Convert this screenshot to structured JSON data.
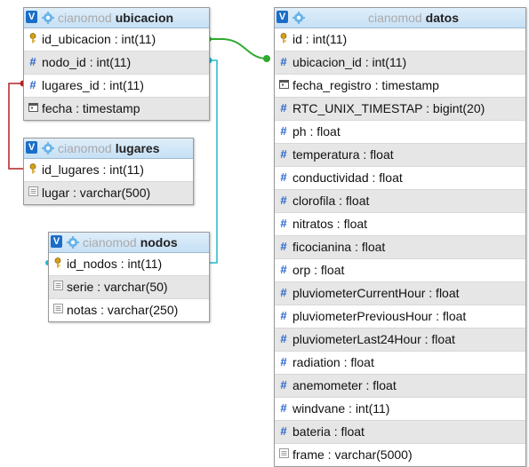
{
  "tables": {
    "ubicacion": {
      "db": "cianomod",
      "name": "ubicacion",
      "columns": [
        {
          "icon": "key-icon",
          "text": "id_ubicacion : int(11)"
        },
        {
          "icon": "hash-icon",
          "text": "nodo_id : int(11)"
        },
        {
          "icon": "hash-icon",
          "text": "lugares_id : int(11)"
        },
        {
          "icon": "calendar-icon",
          "text": "fecha : timestamp"
        }
      ]
    },
    "lugares": {
      "db": "cianomod",
      "name": "lugares",
      "columns": [
        {
          "icon": "key-icon",
          "text": "id_lugares : int(11)"
        },
        {
          "icon": "text-icon",
          "text": "lugar : varchar(500)"
        }
      ]
    },
    "nodos": {
      "db": "cianomod",
      "name": "nodos",
      "columns": [
        {
          "icon": "key-icon",
          "text": "id_nodos : int(11)"
        },
        {
          "icon": "text-icon",
          "text": "serie : varchar(50)"
        },
        {
          "icon": "text-icon",
          "text": "notas : varchar(250)"
        }
      ]
    },
    "datos": {
      "db": "cianomod",
      "name": "datos",
      "columns": [
        {
          "icon": "key-icon",
          "text": "id : int(11)"
        },
        {
          "icon": "hash-icon",
          "text": "ubicacion_id : int(11)"
        },
        {
          "icon": "calendar-icon",
          "text": "fecha_registro : timestamp"
        },
        {
          "icon": "hash-icon",
          "text": "RTC_UNIX_TIMESTAP : bigint(20)"
        },
        {
          "icon": "hash-icon",
          "text": "ph : float"
        },
        {
          "icon": "hash-icon",
          "text": "temperatura : float"
        },
        {
          "icon": "hash-icon",
          "text": "conductividad : float"
        },
        {
          "icon": "hash-icon",
          "text": "clorofila : float"
        },
        {
          "icon": "hash-icon",
          "text": "nitratos : float"
        },
        {
          "icon": "hash-icon",
          "text": "ficocianina : float"
        },
        {
          "icon": "hash-icon",
          "text": "orp : float"
        },
        {
          "icon": "hash-icon",
          "text": "pluviometerCurrentHour : float"
        },
        {
          "icon": "hash-icon",
          "text": "pluviometerPreviousHour : float"
        },
        {
          "icon": "hash-icon",
          "text": "pluviometerLast24Hour : float"
        },
        {
          "icon": "hash-icon",
          "text": "radiation : float"
        },
        {
          "icon": "hash-icon",
          "text": "anemometer : float"
        },
        {
          "icon": "hash-icon",
          "text": "windvane : int(11)"
        },
        {
          "icon": "hash-icon",
          "text": "bateria : float"
        },
        {
          "icon": "text-icon",
          "text": "frame : varchar(5000)"
        }
      ]
    }
  },
  "header_button_label": "V",
  "colors": {
    "link_green": "#2eaa2e",
    "link_red": "#b22222",
    "link_teal": "#22b8c8",
    "header_blue": "#1a6ec7"
  }
}
